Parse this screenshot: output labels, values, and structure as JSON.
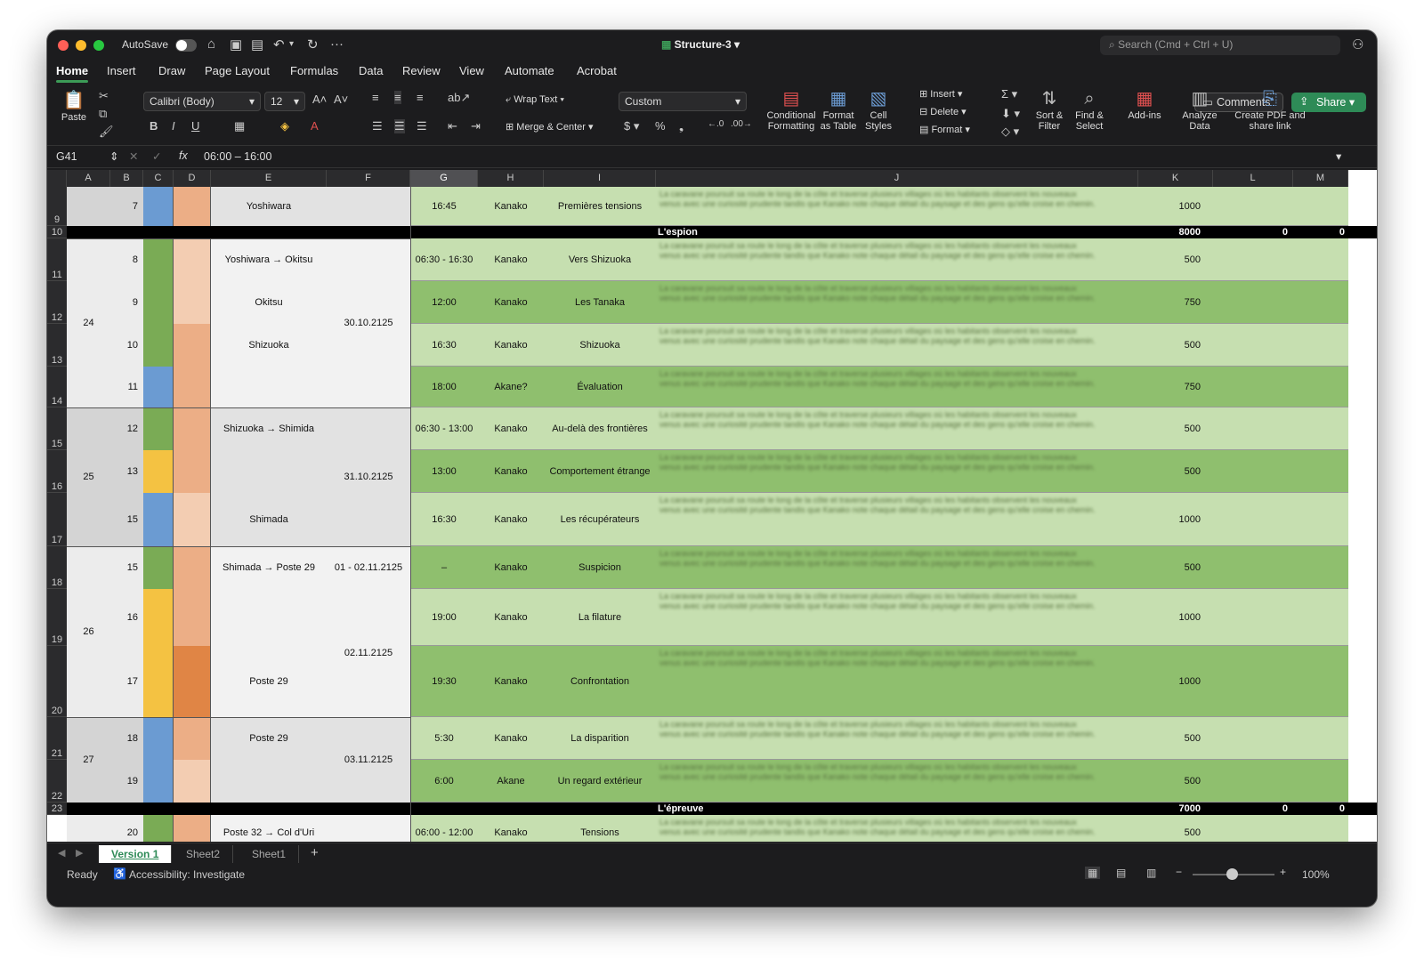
{
  "window": {
    "autosave_label": "AutoSave",
    "doc_title": "Structure-3",
    "search_placeholder": "Search (Cmd + Ctrl + U)"
  },
  "tabs": [
    "Home",
    "Insert",
    "Draw",
    "Page Layout",
    "Formulas",
    "Data",
    "Review",
    "View",
    "Automate",
    "Acrobat"
  ],
  "buttons": {
    "comments": "Comments",
    "share": "Share"
  },
  "ribbon": {
    "paste": "Paste",
    "font": "Calibri (Body)",
    "size": "12",
    "wrap_text": "Wrap Text",
    "merge_center": "Merge & Center",
    "number_format": "Custom",
    "conditional": "Conditional Formatting",
    "format_table": "Format as Table",
    "cell_styles": "Cell Styles",
    "insert": "Insert",
    "delete": "Delete",
    "format": "Format",
    "sort_filter": "Sort & Filter",
    "find_select": "Find & Select",
    "addins": "Add-ins",
    "analyze": "Analyze Data",
    "create_pdf": "Create PDF and share link"
  },
  "formula_bar": {
    "name_box": "G41",
    "fx": "fx",
    "formula": "06:00 – 16:00"
  },
  "columns": [
    "A",
    "B",
    "C",
    "D",
    "E",
    "F",
    "G",
    "H",
    "I",
    "J",
    "K",
    "L",
    "M"
  ],
  "rows": {
    "r9": {
      "b": "7",
      "e": "Yoshiwara",
      "g": "16:45",
      "h": "Kanako",
      "i": "Premières tensions",
      "k": "1000"
    },
    "r10": {
      "title": "L'espion",
      "k": "8000",
      "l": "0",
      "m": "0"
    },
    "r11": {
      "b": "8",
      "e": "Yoshiwara → Okitsu",
      "g": "06:30 - 16:30",
      "h": "Kanako",
      "i": "Vers Shizuoka",
      "k": "500"
    },
    "r12": {
      "a": "24",
      "b": "9",
      "e": "Okitsu",
      "f": "30.10.2125",
      "g": "12:00",
      "h": "Kanako",
      "i": "Les Tanaka",
      "k": "750"
    },
    "r13": {
      "b": "10",
      "e": "Shizuoka",
      "g": "16:30",
      "h": "Kanako",
      "i": "Shizuoka",
      "k": "500"
    },
    "r14": {
      "b": "11",
      "g": "18:00",
      "h": "Akane?",
      "i": "Évaluation",
      "k": "750"
    },
    "r15": {
      "b": "12",
      "e": "Shizuoka → Shimida",
      "g": "06:30 - 13:00",
      "h": "Kanako",
      "i": "Au-delà des frontières",
      "k": "500"
    },
    "r16": {
      "a": "25",
      "b": "13",
      "f": "31.10.2125",
      "g": "13:00",
      "h": "Kanako",
      "i": "Comportement étrange",
      "k": "500"
    },
    "r17": {
      "b": "15",
      "e": "Shimada",
      "g": "16:30",
      "h": "Kanako",
      "i": "Les récupérateurs",
      "k": "1000"
    },
    "r18": {
      "b": "15",
      "e": "Shimada → Poste 29",
      "f": "01 - 02.11.2125",
      "g": "–",
      "h": "Kanako",
      "i": "Suspicion",
      "k": "500"
    },
    "r19": {
      "a": "26",
      "b": "16",
      "g": "19:00",
      "h": "Kanako",
      "i": "La filature",
      "k": "1000"
    },
    "r20": {
      "b": "17",
      "e": "Poste 29",
      "f": "02.11.2125",
      "g": "19:30",
      "h": "Kanako",
      "i": "Confrontation",
      "k": "1000"
    },
    "r21": {
      "a": "27",
      "b": "18",
      "e": "Poste 29",
      "f": "03.11.2125",
      "g": "5:30",
      "h": "Kanako",
      "i": "La disparition",
      "k": "500"
    },
    "r22": {
      "b": "19",
      "g": "6:00",
      "h": "Akane",
      "i": "Un regard extérieur",
      "k": "500"
    },
    "r23": {
      "title": "L'épreuve",
      "k": "7000",
      "l": "0",
      "m": "0"
    },
    "r24": {
      "b": "20",
      "e": "Poste 32 → Col d'Uri",
      "g": "06:00 - 12:00",
      "h": "Kanako",
      "i": "Tensions",
      "k": "500"
    }
  },
  "row_numbers": [
    "9",
    "10",
    "11",
    "12",
    "13",
    "14",
    "15",
    "16",
    "17",
    "18",
    "19",
    "20",
    "21",
    "22",
    "23"
  ],
  "sheets": [
    "Version 1",
    "Sheet2",
    "Sheet1"
  ],
  "status": {
    "ready": "Ready",
    "accessibility": "Accessibility: Investigate",
    "zoom": "100%"
  },
  "colors": {
    "green_dark": "#8fbf6e",
    "green_light": "#c6dfb0",
    "col_c_green": "#7aab55",
    "col_c_blue": "#6b9bd2",
    "col_c_yellow": "#f4c242",
    "col_d_salmon": "#ecae86",
    "col_d_light": "#f3cdb2",
    "col_d_orange": "#e08545",
    "accent": "#2e8b57"
  }
}
